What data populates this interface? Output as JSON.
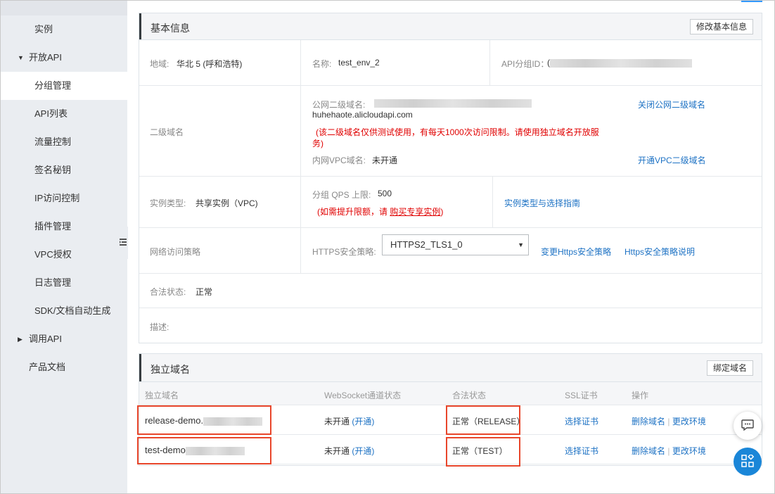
{
  "sidebar": {
    "items": [
      {
        "label": "实例",
        "level": 2
      },
      {
        "label": "开放API",
        "level": 1,
        "expanded": true
      },
      {
        "label": "分组管理",
        "level": 2,
        "active": true
      },
      {
        "label": "API列表",
        "level": 2
      },
      {
        "label": "流量控制",
        "level": 2
      },
      {
        "label": "签名秘钥",
        "level": 2
      },
      {
        "label": "IP访问控制",
        "level": 2
      },
      {
        "label": "插件管理",
        "level": 2
      },
      {
        "label": "VPC授权",
        "level": 2
      },
      {
        "label": "日志管理",
        "level": 2
      },
      {
        "label": "SDK/文档自动生成",
        "level": 2
      },
      {
        "label": "调用API",
        "level": 1,
        "expanded": false
      },
      {
        "label": "产品文档",
        "level": 1
      }
    ]
  },
  "basic": {
    "title": "基本信息",
    "edit_button": "修改基本信息",
    "region_label": "地域:",
    "region_value": "华北 5 (呼和浩特)",
    "name_label": "名称:",
    "name_value": "test_env_2",
    "group_id_label": "API分组ID：",
    "group_id_value": "(",
    "subdomain_label": "二级域名",
    "public_subdomain_label": "公网二级域名:",
    "public_subdomain_value": "huhehaote.alicloudapi.com",
    "subdomain_note_line1": "(该二级域名仅供测试使用，有每天1000次访问限制。请使用独立域名开放服",
    "subdomain_note_line2": "务)",
    "close_public_link": "关闭公网二级域名",
    "vpc_subdomain_label": "内网VPC域名:",
    "vpc_subdomain_value": "未开通",
    "open_vpc_link": "开通VPC二级域名",
    "instance_type_label": "实例类型:",
    "instance_type_value": "共享实例（VPC)",
    "qps_label": "分组 QPS 上限:",
    "qps_value": "500",
    "qps_note_prefix": "(如需提升限额，请 ",
    "qps_note_link": "购买专享实例",
    "qps_note_suffix": ")",
    "instance_guide_link": "实例类型与选择指南",
    "network_label": "网络访问策略",
    "https_label": "HTTPS安全策略:",
    "https_value": "HTTPS2_TLS1_0",
    "change_https_link": "变更Https安全策略",
    "https_doc_link": "Https安全策略说明",
    "legal_label": "合法状态:",
    "legal_value": "正常",
    "desc_label": "描述:"
  },
  "domains": {
    "title": "独立域名",
    "bind_button": "绑定域名",
    "columns": [
      "独立域名",
      "WebSocket通道状态",
      "合法状态",
      "SSL证书",
      "操作"
    ],
    "rows": [
      {
        "domain": "release-demo.",
        "ws_status": "未开通",
        "ws_action": "(开通)",
        "legal": "正常（RELEASE）",
        "ssl": "选择证书",
        "delete": "删除域名",
        "sep": "|",
        "change_env": "更改环境"
      },
      {
        "domain": "test-demo",
        "ws_status": "未开通",
        "ws_action": "(开通)",
        "legal": "正常（TEST）",
        "ssl": "选择证书",
        "delete": "删除域名",
        "sep": "|",
        "change_env": "更改环境"
      }
    ]
  },
  "colors": {
    "link": "#1d72c4",
    "warning": "#e00000",
    "highlight": "#e8462b",
    "fab": "#1a86d8"
  },
  "icons": {
    "collapse": "menu-collapse-icon",
    "chat": "chat-icon",
    "apps": "apps-icon"
  }
}
